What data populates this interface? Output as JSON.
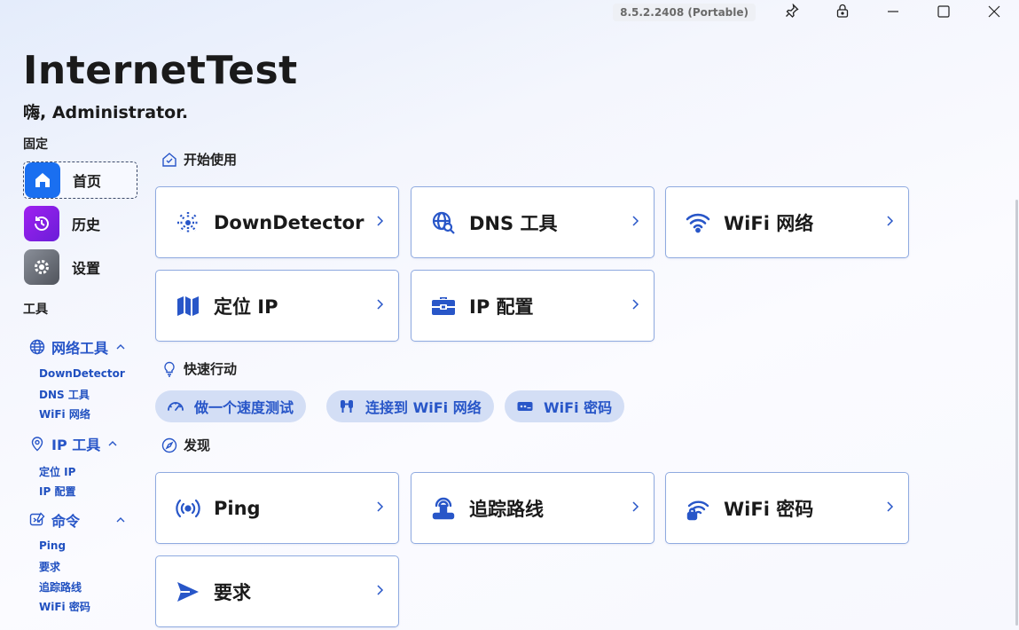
{
  "window": {
    "version": "8.5.2.2408 (Portable)",
    "buttons": [
      "pin",
      "lock",
      "minimize",
      "maximize",
      "close"
    ]
  },
  "app": {
    "title": "InternetTest",
    "greeting": "嗨, Administrator."
  },
  "sidebar": {
    "pinned_label": "固定",
    "pinned": [
      {
        "label": "首页",
        "icon": "home-icon",
        "color": "#1a6ff0"
      },
      {
        "label": "历史",
        "icon": "history-icon",
        "color": "#8a2be2"
      },
      {
        "label": "设置",
        "icon": "gear-icon",
        "color": "#6e7380"
      }
    ],
    "tools_label": "工具",
    "groups": [
      {
        "label": "网络工具",
        "icon": "globe-icon",
        "items": [
          "DownDetector",
          "DNS 工具",
          "WiFi 网络"
        ]
      },
      {
        "label": "IP 工具",
        "icon": "location-icon",
        "items": [
          "定位 IP",
          "IP 配置"
        ]
      },
      {
        "label": "命令",
        "icon": "command-icon",
        "items": [
          "Ping",
          "要求",
          "追踪路线",
          "WiFi 密码"
        ]
      }
    ]
  },
  "main": {
    "get_started": {
      "heading": "开始使用",
      "cards": [
        {
          "label": "DownDetector",
          "icon": "radar-icon"
        },
        {
          "label": "DNS 工具",
          "icon": "dns-icon"
        },
        {
          "label": "WiFi 网络",
          "icon": "wifi-icon"
        },
        {
          "label": "定位 IP",
          "icon": "map-icon"
        },
        {
          "label": "IP 配置",
          "icon": "toolbox-icon"
        }
      ]
    },
    "quick_actions": {
      "heading": "快速行动",
      "pills": [
        {
          "label": "做一个速度测试",
          "icon": "gauge-icon"
        },
        {
          "label": "连接到 WiFi 网络",
          "icon": "connect-icon"
        },
        {
          "label": "WiFi 密码",
          "icon": "password-icon"
        }
      ]
    },
    "discover": {
      "heading": "发现",
      "cards": [
        {
          "label": "Ping",
          "icon": "ping-icon"
        },
        {
          "label": "追踪路线",
          "icon": "route-icon"
        },
        {
          "label": "WiFi 密码",
          "icon": "wifi-lock-icon"
        },
        {
          "label": "要求",
          "icon": "send-icon"
        }
      ]
    }
  },
  "accent_color": "#2856c8"
}
